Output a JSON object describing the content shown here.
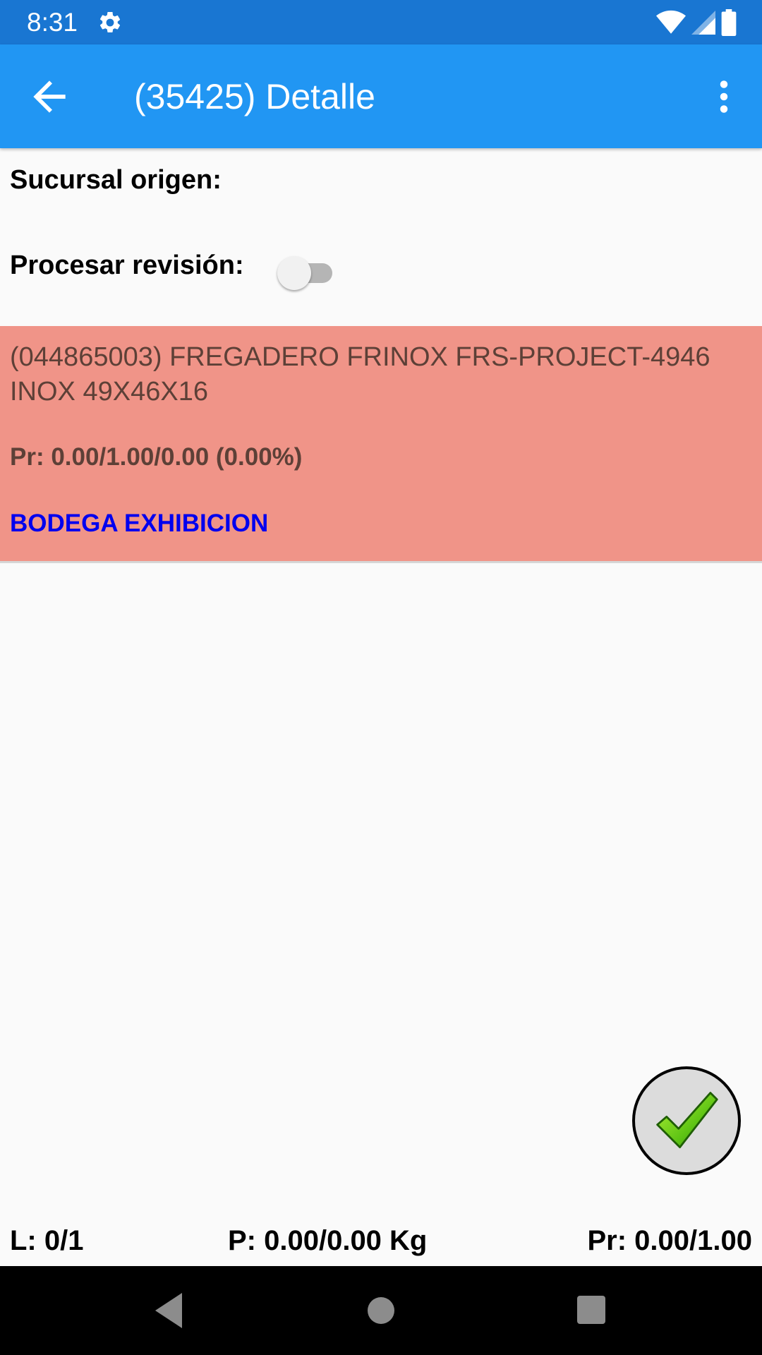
{
  "status_bar": {
    "time": "8:31",
    "icons": [
      "settings-icon",
      "wifi-icon",
      "signal-icon",
      "battery-icon"
    ]
  },
  "app_bar": {
    "title": "(35425) Detalle",
    "back_icon": "arrow-back-icon",
    "menu_icon": "more-vert-icon",
    "color": "#2196f3"
  },
  "form": {
    "sucursal_origen_label": "Sucursal origen:",
    "procesar_revision_label": "Procesar revisión:",
    "procesar_revision_on": false
  },
  "item": {
    "description": "(044865003) FREGADERO FRINOX FRS-PROJECT-4946 INOX 49X46X16",
    "pr": "Pr: 0.00/1.00/0.00 (0.00%)",
    "bodega": "BODEGA EXHIBICION",
    "background_color": "#f09488",
    "bodega_color": "#0000ee"
  },
  "fab": {
    "icon": "checkmark-icon"
  },
  "footer": {
    "lineas": "L: 0/1",
    "peso": "P: 0.00/0.00 Kg",
    "progreso": "Pr: 0.00/1.00"
  },
  "nav_bar": {
    "icons": [
      "nav-back-icon",
      "nav-home-icon",
      "nav-recents-icon"
    ]
  }
}
